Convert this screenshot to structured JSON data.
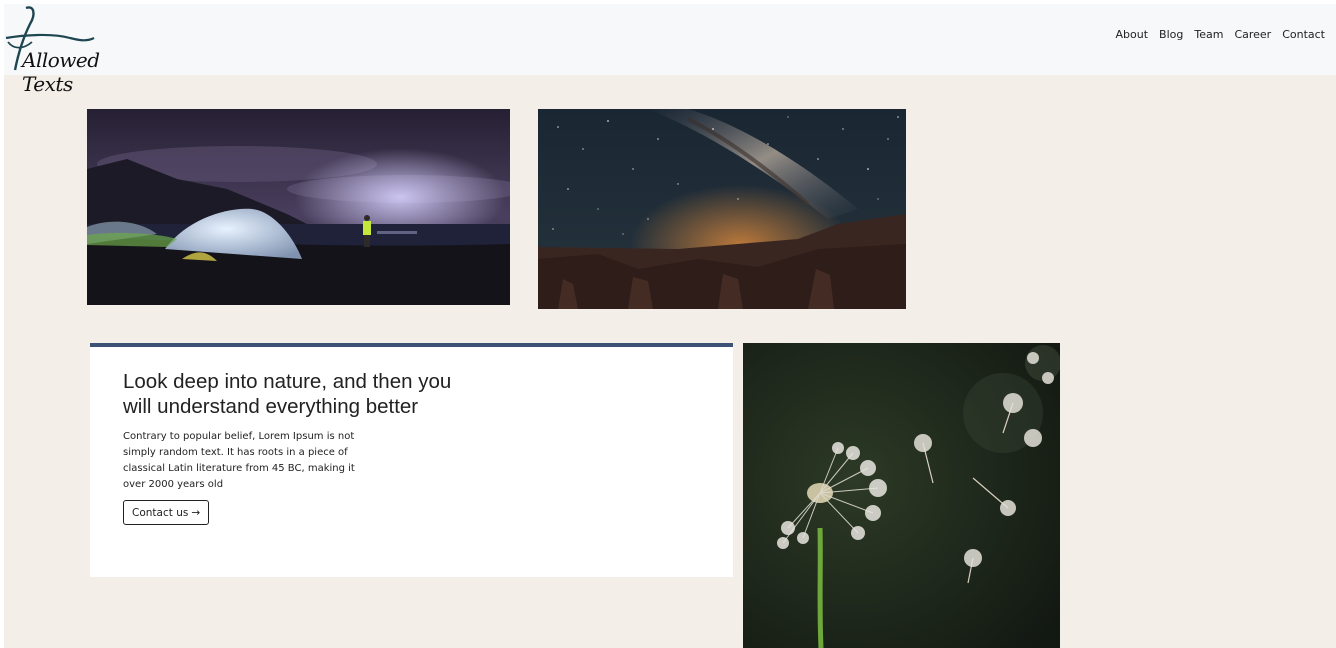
{
  "brand": {
    "name": "Allowed Texts"
  },
  "nav": {
    "items": [
      "About",
      "Blog",
      "Team",
      "Career",
      "Contact"
    ]
  },
  "images": [
    {
      "name": "camping tent at night by the sea"
    },
    {
      "name": "milky way over canyon"
    },
    {
      "name": "dandelion seed head"
    }
  ],
  "card": {
    "title": "Look deep into nature, and then you will understand everything better",
    "body": "Contrary to popular belief, Lorem Ipsum is not simply random text. It has roots in a piece of classical Latin literature from 45 BC, making it over 2000 years old",
    "button_label": "Contact us",
    "button_icon": "arrow-right-icon"
  },
  "colors": {
    "page_background": "#f3eee7",
    "navbar_background": "#f7f8fa",
    "card_accent": "#3d5375",
    "logo_stroke": "#1d4650"
  }
}
